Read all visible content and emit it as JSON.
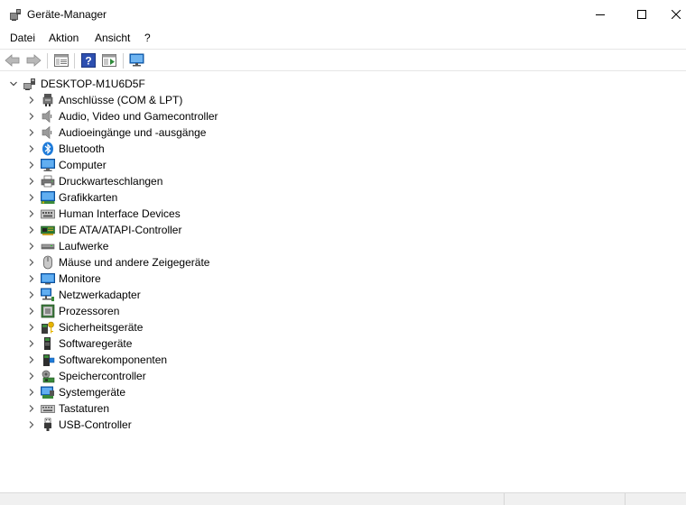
{
  "window": {
    "title": "Geräte-Manager",
    "icon": "device-manager-icon"
  },
  "menu": {
    "items": [
      "Datei",
      "Aktion",
      "Ansicht",
      "?"
    ]
  },
  "toolbar": {
    "buttons": [
      "back-arrow-icon",
      "forward-arrow-icon",
      "properties-icon",
      "help-icon",
      "view-icon",
      "monitor-scan-icon"
    ]
  },
  "tree": {
    "root": "DESKTOP-M1U6D5F",
    "categories": [
      {
        "label": "Anschlüsse (COM & LPT)",
        "icon": "port-icon"
      },
      {
        "label": "Audio, Video und Gamecontroller",
        "icon": "speaker-icon"
      },
      {
        "label": "Audioeingänge und -ausgänge",
        "icon": "speaker-icon"
      },
      {
        "label": "Bluetooth",
        "icon": "bluetooth-icon"
      },
      {
        "label": "Computer",
        "icon": "computer-icon"
      },
      {
        "label": "Druckwarteschlangen",
        "icon": "printer-icon"
      },
      {
        "label": "Grafikkarten",
        "icon": "display-adapter-icon"
      },
      {
        "label": "Human Interface Devices",
        "icon": "hid-icon"
      },
      {
        "label": "IDE ATA/ATAPI-Controller",
        "icon": "ide-controller-icon"
      },
      {
        "label": "Laufwerke",
        "icon": "drive-icon"
      },
      {
        "label": "Mäuse und andere Zeigegeräte",
        "icon": "mouse-icon"
      },
      {
        "label": "Monitore",
        "icon": "monitor-icon"
      },
      {
        "label": "Netzwerkadapter",
        "icon": "network-adapter-icon"
      },
      {
        "label": "Prozessoren",
        "icon": "processor-icon"
      },
      {
        "label": "Sicherheitsgeräte",
        "icon": "security-device-icon"
      },
      {
        "label": "Softwaregeräte",
        "icon": "software-device-icon"
      },
      {
        "label": "Softwarekomponenten",
        "icon": "software-component-icon"
      },
      {
        "label": "Speichercontroller",
        "icon": "storage-controller-icon"
      },
      {
        "label": "Systemgeräte",
        "icon": "system-device-icon"
      },
      {
        "label": "Tastaturen",
        "icon": "keyboard-icon"
      },
      {
        "label": "USB-Controller",
        "icon": "usb-icon"
      }
    ]
  },
  "colors": {
    "accent_blue": "#1e7bd9",
    "help_blue": "#2d4fb0"
  }
}
